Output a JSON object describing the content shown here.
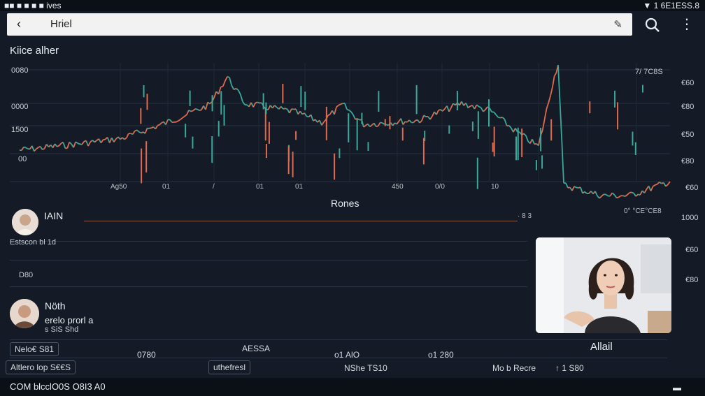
{
  "status": {
    "left": "■■ ■ ■ ■ ■ ives",
    "right": "▼ 1 6E1ESS.8"
  },
  "appbar": {
    "title": "Hriel",
    "back_glyph": "‹",
    "edit_glyph": "✎"
  },
  "toolbar": {
    "more_glyph": "⋮"
  },
  "header": {
    "label": "Kiice alher"
  },
  "chart": {
    "left_ticks": [
      "0080",
      "0000",
      "1500",
      "00"
    ],
    "right_ticks": [
      "7/ 7C8S",
      "€60",
      "€80",
      "€50",
      "€80",
      "€60",
      "1000",
      "€60",
      "€80"
    ],
    "x_ticks": [
      "Ag50",
      "01",
      "/",
      "01",
      "01",
      "450",
      "0/0",
      "10"
    ],
    "title": "Rones",
    "sub_right": "0° °CE°CE8",
    "sub_mid": "· 8 3",
    "series_colors": {
      "up": "#e06a4f",
      "down": "#3aa89a"
    }
  },
  "rows": [
    {
      "name": "IAIN",
      "sub": "Estscon bl 1d"
    },
    {
      "name": "",
      "sub": "D80"
    },
    {
      "name": "Nöth",
      "sub": "erelo prorl a",
      "sub2": "s SiS Shd"
    }
  ],
  "video": {
    "label": "Allail"
  },
  "bottom": {
    "chip1": "Nelo€ S81",
    "chip2": "Altlero lop S€€S",
    "chip3": "uthefresl",
    "f1": "0780",
    "f2": "AESSA",
    "f3": "o1 AlO",
    "f4": "o1 280",
    "f5": "NShe TS10",
    "f6": "Mo b Recre",
    "f7": "↑ 1 S80"
  },
  "footer": {
    "text": "COM blcclO0S O8I3 A0",
    "icon_glyph": "▬"
  }
}
